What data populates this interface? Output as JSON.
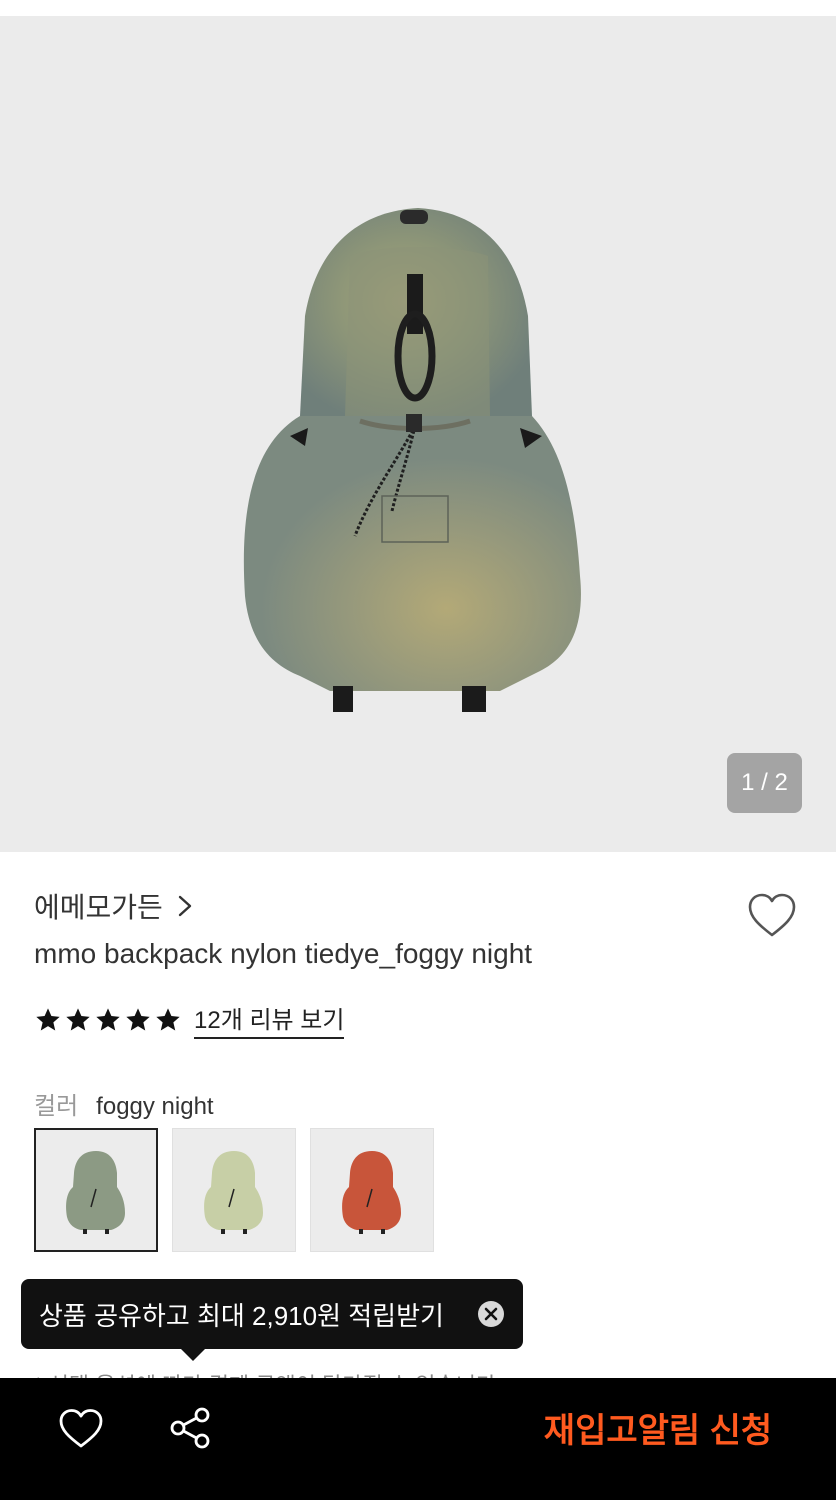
{
  "gallery": {
    "page_indicator": "1 / 2"
  },
  "product": {
    "brand": "에메모가든",
    "title": "mmo backpack nylon tiedye_foggy night",
    "rating_stars": 5,
    "review_link": "12개 리뷰 보기"
  },
  "options": {
    "label": "컬러",
    "selected_value": "foggy night",
    "swatches": [
      {
        "name": "foggy night",
        "color": "#8c9a84"
      },
      {
        "name": "",
        "color": "#c7cfa6"
      },
      {
        "name": "",
        "color": "#c8553a"
      }
    ]
  },
  "notice": "* 선택 옵션에 따라 결제 금액이 달라질 수 있습니다",
  "toast": {
    "text": "상품 공유하고 최대 2,910원 적립받기"
  },
  "bottom_bar": {
    "restock_label": "재입고알림 신청",
    "accent_color": "#ff5a1f"
  }
}
